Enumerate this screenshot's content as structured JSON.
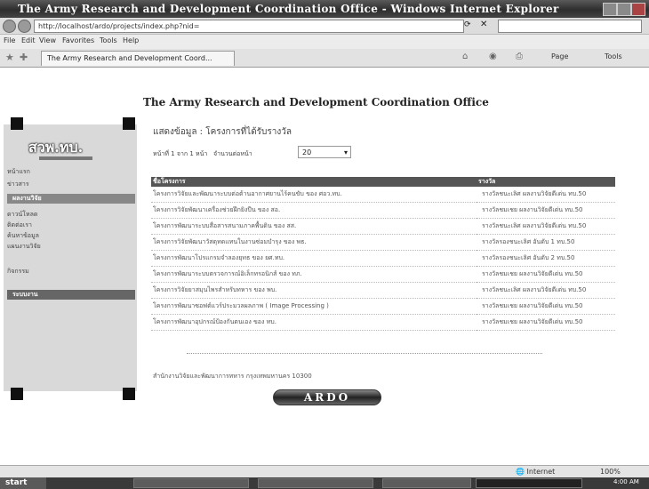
{
  "window": {
    "title": "The Army Research and Development Coordination Office - Windows Internet Explorer"
  },
  "address": {
    "url": "http://localhost/ardo/projects/index.php?nid="
  },
  "menu": [
    "File",
    "Edit",
    "View",
    "Favorites",
    "Tools",
    "Help"
  ],
  "tab": {
    "label": "The Army Research and Development Coord..."
  },
  "commands": {
    "page": "Page",
    "tools": "Tools"
  },
  "sidebar": {
    "logo": "สวพ.ทบ.",
    "items": [
      "หน้าแรก",
      "ข่าวสาร",
      "ผลงานวิจัย",
      "ดาวน์โหลด",
      "ติดต่อเรา",
      "ค้นหาข้อมูล",
      "แผนงานวิจัย",
      "กิจกรรม",
      "ระบบงาน"
    ]
  },
  "content": {
    "heading": "The Army Research and Development Coordination Office",
    "subheading": "แสดงข้อมูล : โครงการที่ได้รับรางวัล",
    "pager": "หน้าที่ 1 จาก 1 หน้า",
    "per_page_label": "จำนวนต่อหน้า",
    "per_page_value": "20",
    "table": {
      "headers": [
        "ชื่อโครงการ",
        "รางวัล"
      ],
      "rows": [
        [
          "โครงการวิจัยและพัฒนาระบบต่อต้านอากาศยานไร้คนขับ ของ ศอว.ทบ.",
          "รางวัลชนะเลิศ ผลงานวิจัยดีเด่น ทบ.50"
        ],
        [
          "โครงการวิจัยพัฒนาเครื่องช่วยฝึกยิงปืน ของ สอ.",
          "รางวัลชมเชย ผลงานวิจัยดีเด่น ทบ.50"
        ],
        [
          "โครงการพัฒนาระบบสื่อสารสนามภาคพื้นดิน ของ สส.",
          "รางวัลชนะเลิศ ผลงานวิจัยดีเด่น ทบ.50"
        ],
        [
          "โครงการวิจัยพัฒนาวัสดุทดแทนในงานซ่อมบำรุง ของ พธ.",
          "รางวัลรองชนะเลิศ อันดับ 1 ทบ.50"
        ],
        [
          "โครงการพัฒนาโปรแกรมจำลองยุทธ ของ ยศ.ทบ.",
          "รางวัลรองชนะเลิศ อันดับ 2 ทบ.50"
        ],
        [
          "โครงการพัฒนาระบบตรวจการณ์อิเล็กทรอนิกส์ ของ ทภ.",
          "รางวัลชมเชย ผลงานวิจัยดีเด่น ทบ.50"
        ],
        [
          "โครงการวิจัยยาสมุนไพรสำหรับทหาร ของ พบ.",
          "รางวัลชนะเลิศ ผลงานวิจัยดีเด่น ทบ.50"
        ],
        [
          "โครงการพัฒนาซอฟต์แวร์ประมวลผลภาพ ( Image Processing )",
          "รางวัลชมเชย ผลงานวิจัยดีเด่น ทบ.50"
        ],
        [
          "โครงการพัฒนาอุปกรณ์ป้องกันตนเอง ของ ทบ.",
          "รางวัลชมเชย ผลงานวิจัยดีเด่น ทบ.50"
        ]
      ]
    },
    "footer": "สำนักงานวิจัยและพัฒนาการทหาร กรุงเทพมหานคร 10300",
    "brand": "ARDO"
  },
  "status": {
    "zone": "Internet",
    "zoom": "100%"
  },
  "taskbar": {
    "start": "start",
    "clock": "4:00 AM"
  }
}
